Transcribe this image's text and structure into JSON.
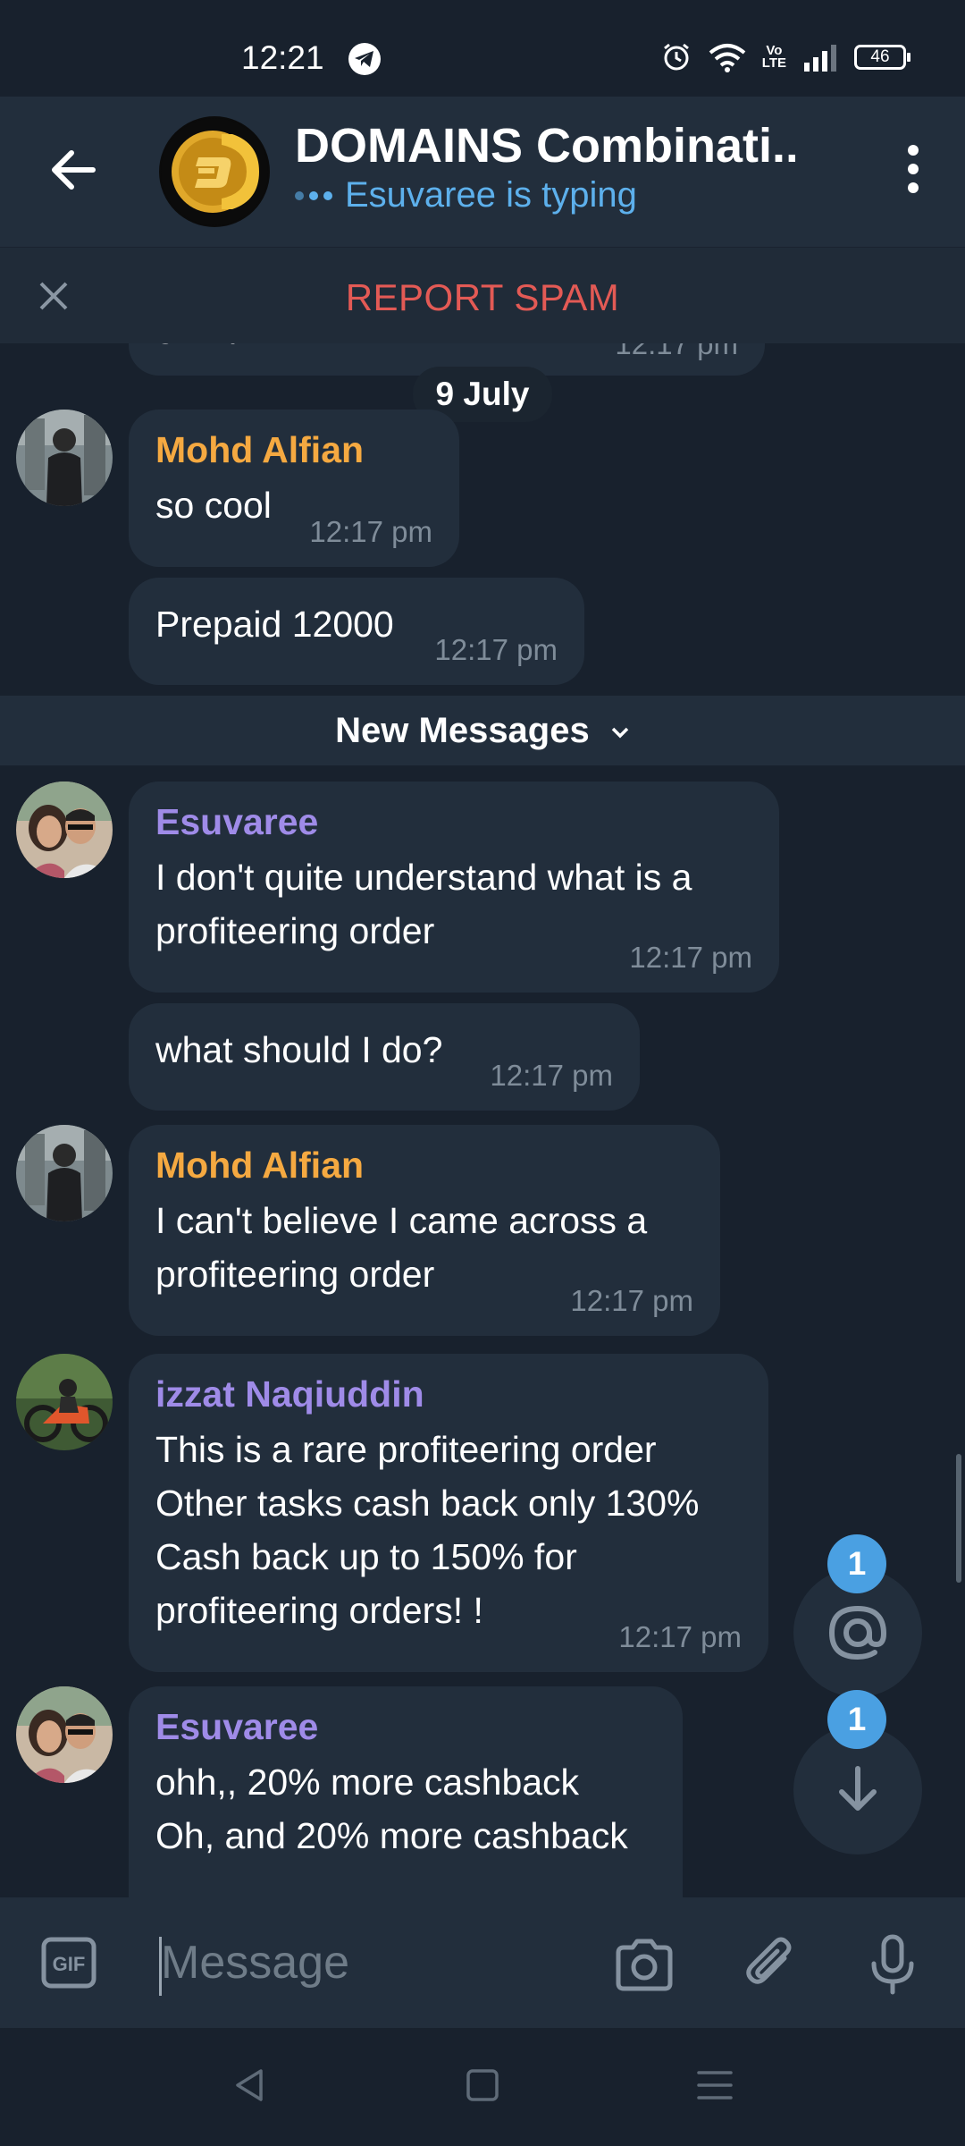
{
  "status": {
    "time": "12:21",
    "volte": "Vo\nLTE",
    "battery": "46"
  },
  "header": {
    "title": "DOMAINS Combinati...",
    "status": "Esuvaree is typing"
  },
  "spam": {
    "label": "REPORT SPAM"
  },
  "chat": {
    "top_partial": {
      "text": "group.",
      "time": "12:17 pm"
    },
    "date_separator": "9 July",
    "messages": [
      {
        "sender": "Mohd Alfian",
        "text": "so cool",
        "time": "12:17 pm"
      },
      {
        "sender": "",
        "text": "Prepaid 12000",
        "time": "12:17 pm"
      },
      {
        "sender": "Esuvaree",
        "text": "I don't quite understand what is a profiteering order",
        "time": "12:17 pm"
      },
      {
        "sender": "",
        "text": "what should I do?",
        "time": "12:17 pm"
      },
      {
        "sender": "Mohd Alfian",
        "text": "I can't believe I came across a profiteering order",
        "time": "12:17 pm"
      },
      {
        "sender": "izzat Naqiuddin",
        "lines": [
          "This is a rare profiteering order",
          "Other tasks cash back only 130%",
          "Cash back up to 150% for",
          "profiteering orders! !"
        ],
        "time": "12:17 pm"
      },
      {
        "sender": "Esuvaree",
        "lines": [
          "ohh,, 20% more cashback",
          "Oh, and 20% more cashback"
        ]
      }
    ],
    "new_messages_label": "New Messages"
  },
  "fabs": {
    "mentions_badge": "1",
    "scroll_badge": "1"
  },
  "input": {
    "placeholder": "Message"
  },
  "colors": {
    "background": "#18212d",
    "bubble": "#222e3c",
    "alfian": "#f5a941",
    "esuvaree": "#9f8be8",
    "izzat": "#9f8be8",
    "accent": "#4aa0e2",
    "spam": "#e35a55"
  }
}
